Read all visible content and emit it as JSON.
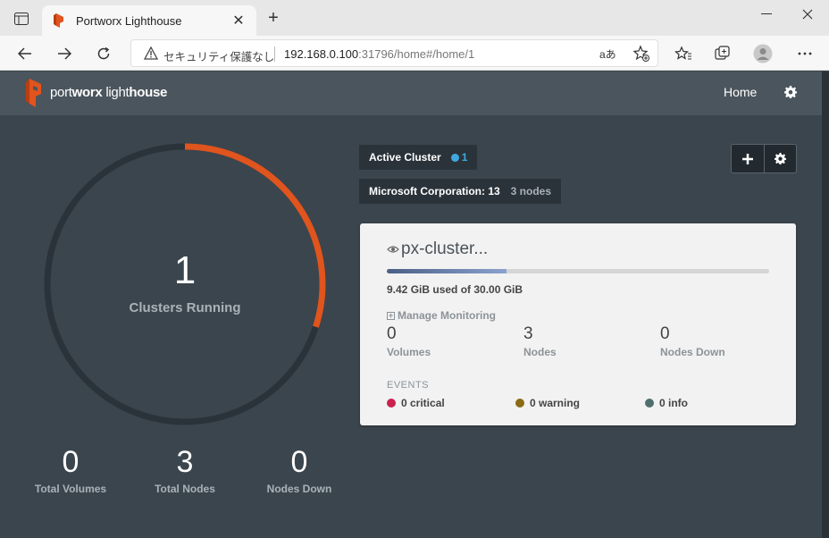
{
  "browser": {
    "tab_title": "Portworx Lighthouse",
    "tab_close": "✕",
    "new_tab": "+",
    "security_text": "セキュリティ保護なし",
    "url_host": "192.168.0.100",
    "url_rest": ":31796/home#/home/1",
    "read_aloud": "aあ"
  },
  "app": {
    "logo_part1": "port",
    "logo_part2": "worx",
    "logo_part3": " light",
    "logo_part4": "house",
    "nav_home": "Home"
  },
  "summary": {
    "clusters_running_count": "1",
    "clusters_running_label": "Clusters Running",
    "ring_fraction": 0.3,
    "accent_color": "#e0541e",
    "total_volumes": "0",
    "total_volumes_label": "Total Volumes",
    "total_nodes": "3",
    "total_nodes_label": "Total Nodes",
    "nodes_down": "0",
    "nodes_down_label": "Nodes Down"
  },
  "active_cluster": {
    "label": "Active Cluster",
    "count": "1",
    "org_name": "Microsoft Corporation: 13",
    "org_nodes": "3 nodes"
  },
  "card": {
    "title": "px-cluster...",
    "used_fraction": 0.314,
    "usage_text": "9.42 GiB used of 30.00 GiB",
    "manage_monitoring": "Manage Monitoring",
    "volumes_count": "0",
    "volumes_label": "Volumes",
    "nodes_count": "3",
    "nodes_label": "Nodes",
    "nodes_down_count": "0",
    "nodes_down_label": "Nodes Down",
    "events_label": "EVENTS",
    "critical": "0 critical",
    "warning": "0 warning",
    "info": "0 info",
    "critical_color": "#c8224d",
    "warning_color": "#8a6a12",
    "info_color": "#4f6f6f"
  }
}
